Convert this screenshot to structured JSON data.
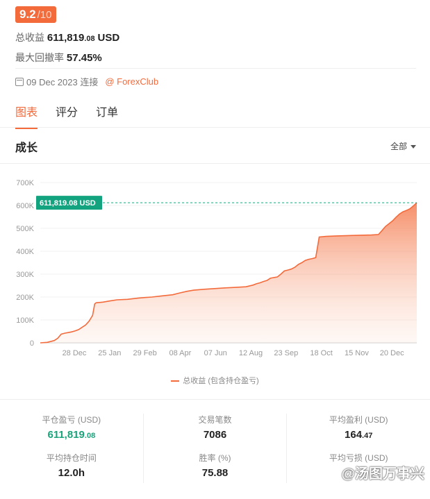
{
  "rating": {
    "score": "9.2",
    "denom": "/10"
  },
  "summary": {
    "total_label": "总收益",
    "total_value_main": "611,819",
    "total_value_dec": ".08",
    "total_currency": "USD",
    "drawdown_label": "最大回撤率",
    "drawdown_value": "57.45%"
  },
  "meta": {
    "date": "09 Dec 2023 连接",
    "broker": "@ ForexClub"
  },
  "tabs": [
    {
      "label": "图表"
    },
    {
      "label": "评分"
    },
    {
      "label": "订单"
    }
  ],
  "section": {
    "title": "成长",
    "range": "全部"
  },
  "chart_data": {
    "type": "area",
    "ylabels": [
      "700K",
      "600K",
      "500K",
      "400K",
      "300K",
      "200K",
      "100K",
      "0"
    ],
    "ylim": [
      0,
      700000
    ],
    "xlabels": [
      "28 Dec",
      "25 Jan",
      "29 Feb",
      "08 Apr",
      "07 Jun",
      "12 Aug",
      "23 Sep",
      "18 Oct",
      "15 Nov",
      "20 Dec"
    ],
    "xlim": [
      0,
      108
    ],
    "points": [
      [
        0,
        0
      ],
      [
        2,
        2000
      ],
      [
        4,
        10000
      ],
      [
        5,
        20000
      ],
      [
        6,
        38000
      ],
      [
        7,
        42000
      ],
      [
        8,
        45000
      ],
      [
        9,
        48000
      ],
      [
        10,
        52000
      ],
      [
        11,
        58000
      ],
      [
        12,
        68000
      ],
      [
        13,
        78000
      ],
      [
        14,
        95000
      ],
      [
        15,
        120000
      ],
      [
        15.6,
        170000
      ],
      [
        16,
        175000
      ],
      [
        18,
        178000
      ],
      [
        20,
        183000
      ],
      [
        22,
        188000
      ],
      [
        25,
        190000
      ],
      [
        28,
        195000
      ],
      [
        30,
        198000
      ],
      [
        32,
        200000
      ],
      [
        35,
        205000
      ],
      [
        38,
        210000
      ],
      [
        40,
        218000
      ],
      [
        42,
        225000
      ],
      [
        44,
        230000
      ],
      [
        47,
        234000
      ],
      [
        50,
        237000
      ],
      [
        53,
        240000
      ],
      [
        56,
        242000
      ],
      [
        59,
        245000
      ],
      [
        61,
        252000
      ],
      [
        62,
        258000
      ],
      [
        63,
        262000
      ],
      [
        64,
        268000
      ],
      [
        65,
        272000
      ],
      [
        66,
        282000
      ],
      [
        67,
        285000
      ],
      [
        68,
        288000
      ],
      [
        69,
        300000
      ],
      [
        70,
        314000
      ],
      [
        71,
        318000
      ],
      [
        72,
        322000
      ],
      [
        73,
        330000
      ],
      [
        74,
        342000
      ],
      [
        75,
        350000
      ],
      [
        76,
        360000
      ],
      [
        77,
        365000
      ],
      [
        78,
        368000
      ],
      [
        79,
        372000
      ],
      [
        80,
        462000
      ],
      [
        82,
        465000
      ],
      [
        85,
        467000
      ],
      [
        90,
        469000
      ],
      [
        95,
        471000
      ],
      [
        97,
        473000
      ],
      [
        98,
        490000
      ],
      [
        99,
        508000
      ],
      [
        100,
        520000
      ],
      [
        101,
        532000
      ],
      [
        102,
        548000
      ],
      [
        103,
        562000
      ],
      [
        104,
        572000
      ],
      [
        105,
        578000
      ],
      [
        106,
        585000
      ],
      [
        107,
        598000
      ],
      [
        108,
        611819
      ]
    ],
    "marker_label": "611,819.08 USD",
    "marker_value": 611819.08,
    "legend": "总收益 (包含持仓盈亏)"
  },
  "stats": {
    "col1": {
      "l1": "平仓盈亏 (USD)",
      "v1_main": "611,819",
      "v1_dec": ".08",
      "l2": "平均持仓时间",
      "v2": "12.0h"
    },
    "col2": {
      "l1": "交易笔数",
      "v1": "7086",
      "l2": "胜率 (%)",
      "v2": "75.88"
    },
    "col3": {
      "l1": "平均盈利 (USD)",
      "v1_main": "164",
      "v1_dec": ".47",
      "l2": "平均亏损 (USD)",
      "v2": ""
    }
  },
  "watermark": "@汤图万事兴"
}
